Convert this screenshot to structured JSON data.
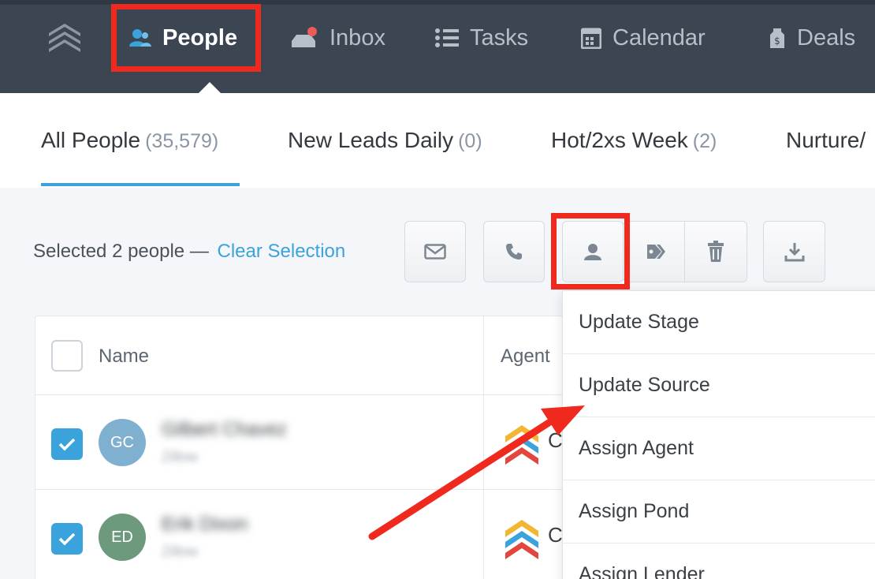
{
  "nav": {
    "logo_icon": "app-logo-icon",
    "items": [
      {
        "label": "People",
        "icon": "people-icon",
        "active": true
      },
      {
        "label": "Inbox",
        "icon": "inbox-icon",
        "notification": true
      },
      {
        "label": "Tasks",
        "icon": "tasks-icon"
      },
      {
        "label": "Calendar",
        "icon": "calendar-icon"
      },
      {
        "label": "Deals",
        "icon": "deals-icon"
      }
    ]
  },
  "subtabs": [
    {
      "label": "All People",
      "count": "(35,579)",
      "active": true
    },
    {
      "label": "New Leads Daily",
      "count": "(0)"
    },
    {
      "label": "Hot/2xs Week",
      "count": "(2)"
    },
    {
      "label": "Nurture/",
      "count": ""
    }
  ],
  "selection": {
    "text": "Selected 2 people —",
    "clear_label": "Clear Selection"
  },
  "toolbar": {
    "buttons": [
      "email-icon",
      "phone-icon",
      "person-icon",
      "tag-icon",
      "trash-icon",
      "download-icon"
    ]
  },
  "table": {
    "headers": {
      "name": "Name",
      "agent": "Agent"
    },
    "rows": [
      {
        "initials": "GC",
        "name": "Gilbert Chavez",
        "sub": "Zillow",
        "avatar_color": "#7fb0cf",
        "agent_letter": "C",
        "checked": true
      },
      {
        "initials": "ED",
        "name": "Erik Dixon",
        "sub": "Zillow",
        "avatar_color": "#6d9a7c",
        "agent_letter": "C",
        "checked": true
      }
    ]
  },
  "dropdown": {
    "items": [
      "Update Stage",
      "Update Source",
      "Assign Agent",
      "Assign Pond",
      "Assign Lender"
    ]
  },
  "colors": {
    "accent": "#3ba3dc",
    "nav_bg": "#3b4652",
    "annotation": "#f0291e"
  }
}
